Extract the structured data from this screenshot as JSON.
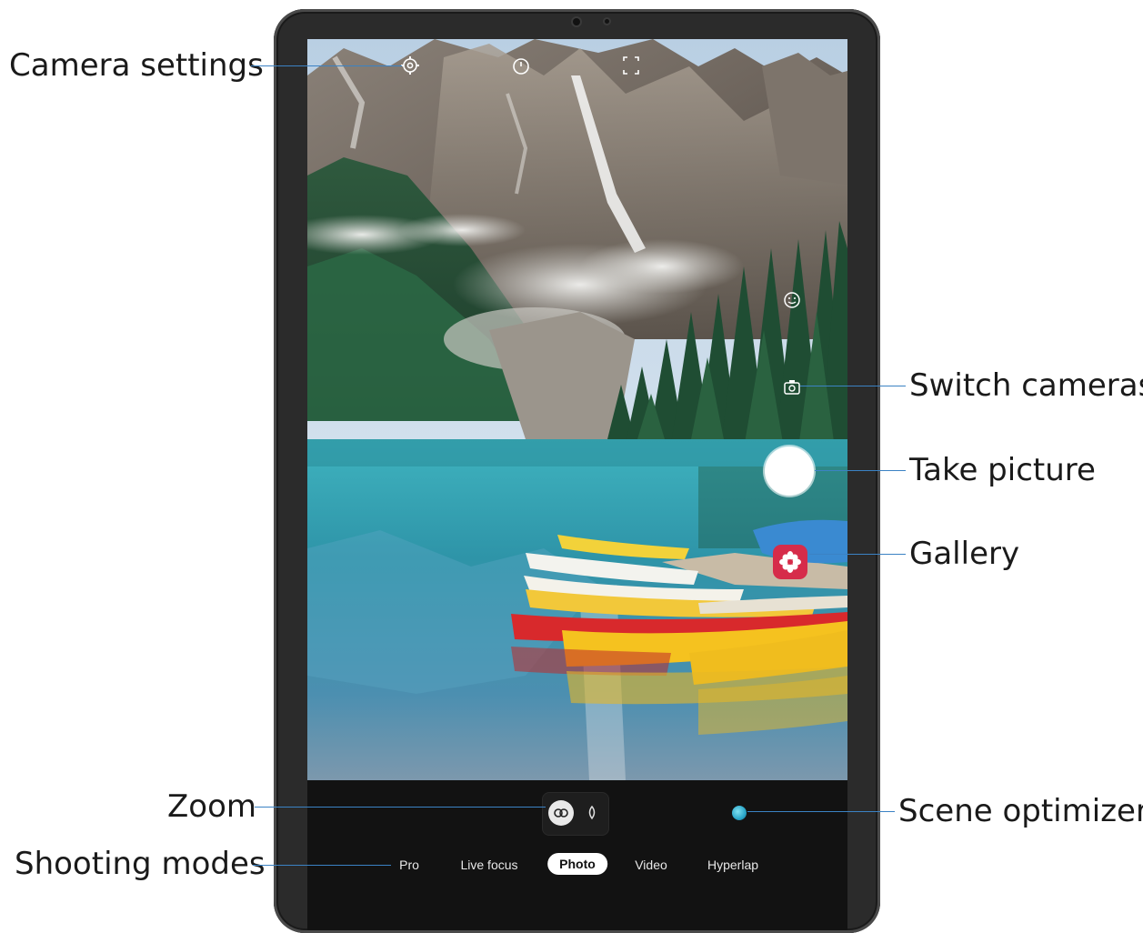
{
  "callouts": {
    "camera_settings": "Camera settings",
    "switch_cameras": "Switch cameras",
    "take_picture": "Take picture",
    "gallery": "Gallery",
    "zoom": "Zoom",
    "scene_optimizer": "Scene optimizer",
    "shooting_modes": "Shooting modes"
  },
  "camera_app": {
    "top_icons": [
      "settings-icon",
      "timer-icon",
      "aspect-ratio-icon"
    ],
    "side_icons": [
      "face-effects-icon",
      "switch-camera-icon"
    ],
    "zoom_icons": [
      "wide-lens-icon",
      "standard-lens-icon"
    ],
    "modes": [
      {
        "label": "Pro",
        "active": false
      },
      {
        "label": "Live focus",
        "active": false
      },
      {
        "label": "Photo",
        "active": true
      },
      {
        "label": "Video",
        "active": false
      },
      {
        "label": "Hyperlap",
        "active": false
      }
    ]
  },
  "colors": {
    "leader_line": "#3b82c4",
    "gallery_badge": "#d62c4a",
    "scene_optimizer_dot": "#2aa6c9"
  }
}
